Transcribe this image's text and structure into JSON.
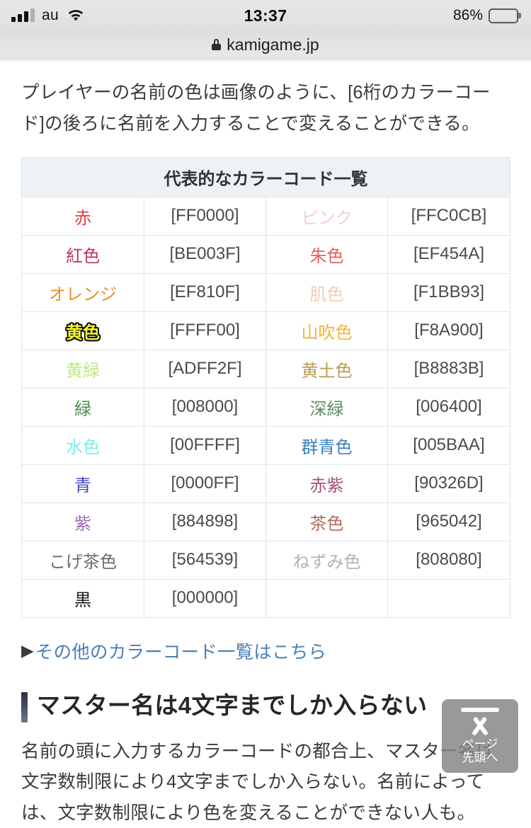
{
  "status_bar": {
    "carrier": "au",
    "time": "13:37",
    "battery_percent": "86%",
    "signal_bars_filled": 3,
    "signal_bars_total": 4,
    "icons": [
      "signal-icon",
      "wifi-icon",
      "battery-icon"
    ]
  },
  "browser": {
    "lock_icon": "lock-icon",
    "url": "kamigame.jp"
  },
  "article": {
    "intro_paragraph": "プレイヤーの名前の色は画像のように、[6桁のカラーコード]の後ろに名前を入力することで変えることができる。",
    "more_link": {
      "marker": "▶",
      "label": "その他のカラーコード一覧はこちら"
    },
    "section_heading": "マスター名は4文字までしか入らない",
    "section_paragraph": "名前の頭に入力するカラーコードの都合上、マスター名は文字数制限により4文字までしか入らない。名前によっては、文字数制限により色を変えることができない人も。"
  },
  "color_table": {
    "caption": "代表的なカラーコード一覧",
    "header_bg": "#eef2f4",
    "border_color": "#e2e4e6",
    "code_text_color": "#4a4a4a",
    "rows": [
      [
        {
          "name": "赤",
          "color": "#e04141",
          "code": "[FF0000]",
          "outlined": false
        },
        {
          "name": "ピンク",
          "color": "#f6cdd3",
          "code": "[FFC0CB]",
          "outlined": false
        }
      ],
      [
        {
          "name": "紅色",
          "color": "#b9355e",
          "code": "[BE003F]",
          "outlined": false
        },
        {
          "name": "朱色",
          "color": "#e8605f",
          "code": "[EF454A]",
          "outlined": false
        }
      ],
      [
        {
          "name": "オレンジ",
          "color": "#e8912b",
          "code": "[EF810F]",
          "outlined": false
        },
        {
          "name": "肌色",
          "color": "#f1cdb6",
          "code": "[F1BB93]",
          "outlined": false
        }
      ],
      [
        {
          "name": "黄色",
          "color": "#f5f531",
          "code": "[FFFF00]",
          "outlined": true
        },
        {
          "name": "山吹色",
          "color": "#f0b637",
          "code": "[F8A900]",
          "outlined": false
        }
      ],
      [
        {
          "name": "黄緑",
          "color": "#bde887",
          "code": "[ADFF2F]",
          "outlined": false
        },
        {
          "name": "黄土色",
          "color": "#b89a57",
          "code": "[B8883B]",
          "outlined": false
        }
      ],
      [
        {
          "name": "緑",
          "color": "#4b8b4b",
          "code": "[008000]",
          "outlined": false
        },
        {
          "name": "深緑",
          "color": "#5f8a63",
          "code": "[006400]",
          "outlined": false
        }
      ],
      [
        {
          "name": "水色",
          "color": "#82ecec",
          "code": "[00FFFF]",
          "outlined": false
        },
        {
          "name": "群青色",
          "color": "#3a7fbd",
          "code": "[005BAA]",
          "outlined": false
        }
      ],
      [
        {
          "name": "青",
          "color": "#4545c8",
          "code": "[0000FF]",
          "outlined": false
        },
        {
          "name": "赤紫",
          "color": "#a94f7d",
          "code": "[90326D]",
          "outlined": false
        }
      ],
      [
        {
          "name": "紫",
          "color": "#9a6fb0",
          "code": "[884898]",
          "outlined": false
        },
        {
          "name": "茶色",
          "color": "#b06d5d",
          "code": "[965042]",
          "outlined": false
        }
      ],
      [
        {
          "name": "こげ茶色",
          "color": "#6f6a64",
          "code": "[564539]",
          "outlined": false
        },
        {
          "name": "ねずみ色",
          "color": "#b3b3b3",
          "code": "[808080]",
          "outlined": false
        }
      ],
      [
        {
          "name": "黒",
          "color": "#1a1a1a",
          "code": "[000000]",
          "outlined": false
        },
        {
          "name": "",
          "color": "#000000",
          "code": "",
          "outlined": false
        }
      ]
    ]
  },
  "page_top_button": {
    "line1": "ページ",
    "line2": "先頭へ",
    "icon": "chevron-up-icon"
  }
}
